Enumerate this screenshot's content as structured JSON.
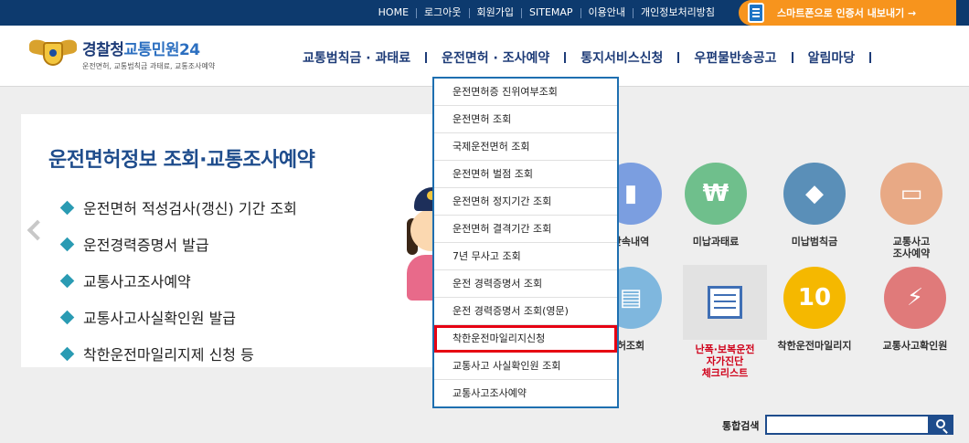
{
  "top_nav": {
    "links": [
      "HOME",
      "로그아웃",
      "회원가입",
      "SITEMAP",
      "이용안내",
      "개인정보처리방침"
    ],
    "smart_banner": "스마트폰으로 인증서 내보내기 →"
  },
  "logo": {
    "title_main": "경찰청",
    "title_accent": "교통민원24",
    "subtitle": "운전면허, 교통범칙금 과태료, 교통조사예약"
  },
  "gnb": {
    "items": [
      "교통범칙금 · 과태료",
      "운전면허 · 조사예약",
      "통지서비스신청",
      "우편물반송공고",
      "알림마당"
    ]
  },
  "dropdown": {
    "items": [
      "운전면허증 진위여부조회",
      "운전면허 조회",
      "국제운전면허 조회",
      "운전면허 벌점 조회",
      "운전면허 정지기간 조회",
      "운전면허 결격기간 조회",
      "7년 무사고 조회",
      "운전 경력증명서 조회",
      "운전 경력증명서 조회(영문)",
      "착한운전마일리지신청",
      "교통사고 사실확인원 조회",
      "교통사고조사예약"
    ],
    "active_index": 9
  },
  "panel": {
    "title": "운전면허정보 조회·교통조사예약",
    "items": [
      "운전면허 적성검사(갱신) 기간 조회",
      "운전경력증명서 발급",
      "교통사고조사예약",
      "교통사고사실확인원 발급",
      "착한운전마일리지제 신청 등"
    ]
  },
  "services": {
    "row1": [
      {
        "label": "단속내역",
        "icon": "camera-icon",
        "color": "#7b9ee0"
      },
      {
        "label": "미납과태료",
        "icon": "money-icon",
        "color": "#6fbf8c"
      },
      {
        "label": "미납범칙금",
        "icon": "warning-icon",
        "color": "#5a8fb8"
      },
      {
        "label": "교통사고\n조사예약",
        "icon": "computer-icon",
        "color": "#e8a985"
      }
    ],
    "row2": [
      {
        "label": "허조회",
        "icon": "card-icon",
        "color": "#7fb7de"
      },
      {
        "label": "난폭·보복운전\n자가진단\n체크리스트",
        "icon": "checklist-icon",
        "color": "#e2e2e2"
      },
      {
        "label": "착한운전마일리지",
        "icon": "mileage-icon",
        "color": "#f5b800"
      },
      {
        "label": "교통사고확인원",
        "icon": "accident-icon",
        "color": "#e07a7a"
      }
    ]
  },
  "search": {
    "label": "통합검색",
    "placeholder": ""
  }
}
